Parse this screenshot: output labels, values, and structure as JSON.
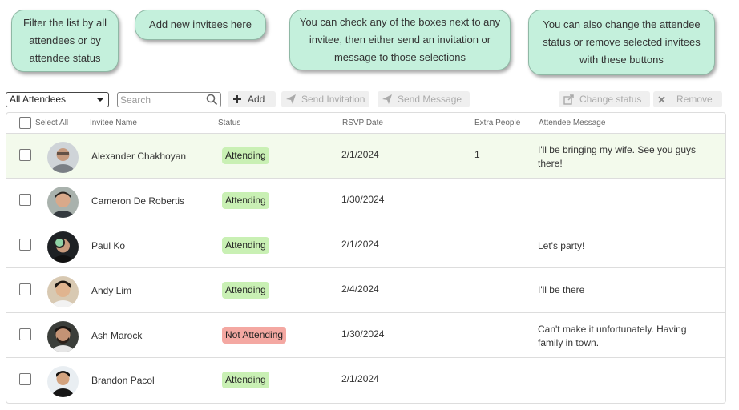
{
  "callouts": {
    "filter": "Filter the list by all attendees or by attendee status",
    "add": "Add new invitees here",
    "check": "You can check any of the boxes next to any invitee, then either send an invitation or message to those selections",
    "status": "You can also change the attendee status or remove selected invitees with these buttons"
  },
  "toolbar": {
    "filter_value": "All Attendees",
    "search_placeholder": "Search",
    "add_label": "Add",
    "send_invitation_label": "Send Invitation",
    "send_message_label": "Send Message",
    "change_status_label": "Change status",
    "remove_label": "Remove"
  },
  "table": {
    "headers": {
      "select_all": "Select All",
      "name": "Invitee Name",
      "status": "Status",
      "rsvp": "RSVP Date",
      "extra": "Extra People",
      "message": "Attendee Message"
    },
    "rows": [
      {
        "name": "Alexander Chakhoyan",
        "status": "Attending",
        "rsvp": "2/1/2024",
        "extra": "1",
        "message": "I'll be bringing my wife. See you guys there!"
      },
      {
        "name": "Cameron De Robertis",
        "status": "Attending",
        "rsvp": "1/30/2024",
        "extra": "",
        "message": ""
      },
      {
        "name": "Paul Ko",
        "status": "Attending",
        "rsvp": "2/1/2024",
        "extra": "",
        "message": "Let's party!"
      },
      {
        "name": "Andy Lim",
        "status": "Attending",
        "rsvp": "2/4/2024",
        "extra": "",
        "message": "I'll be there"
      },
      {
        "name": "Ash Marock",
        "status": "Not Attending",
        "rsvp": "1/30/2024",
        "extra": "",
        "message": "Can't make it unfortunately. Having family in town."
      },
      {
        "name": "Brandon Pacol",
        "status": "Attending",
        "rsvp": "2/1/2024",
        "extra": "",
        "message": ""
      }
    ]
  },
  "colors": {
    "callout_bg": "#c4f0dc",
    "attending": "#c9f0b4",
    "not_attending": "#f4a8a2",
    "highlight_row": "#f3faec"
  }
}
